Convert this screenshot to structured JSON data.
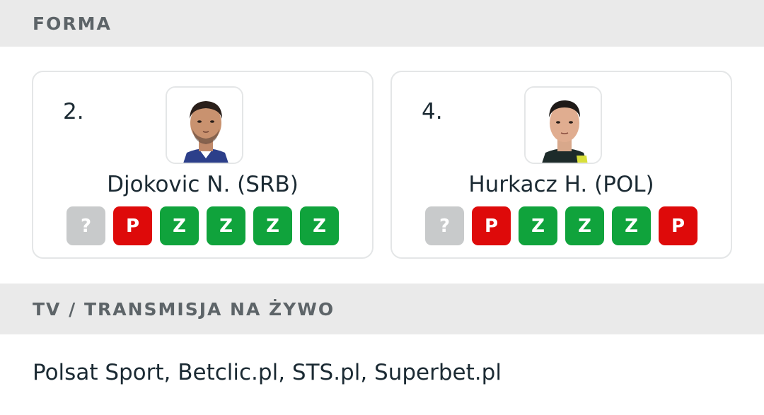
{
  "form_section": {
    "title": "FORMA"
  },
  "players": [
    {
      "rank": "2.",
      "name": "Djokovic N. (SRB)",
      "photo": "djokovic-photo",
      "form": [
        "?",
        "P",
        "Z",
        "Z",
        "Z",
        "Z"
      ]
    },
    {
      "rank": "4.",
      "name": "Hurkacz H. (POL)",
      "photo": "hurkacz-photo",
      "form": [
        "?",
        "P",
        "Z",
        "Z",
        "Z",
        "P"
      ]
    }
  ],
  "tv_section": {
    "title": "TV / TRANSMISJA NA ŻYWO",
    "channels": "Polsat Sport, Betclic.pl, STS.pl, Superbet.pl"
  },
  "colors": {
    "win": "#10a33c",
    "loss": "#de0a0a",
    "unknown": "#c8cacb",
    "header_bg": "#eaeaea"
  }
}
